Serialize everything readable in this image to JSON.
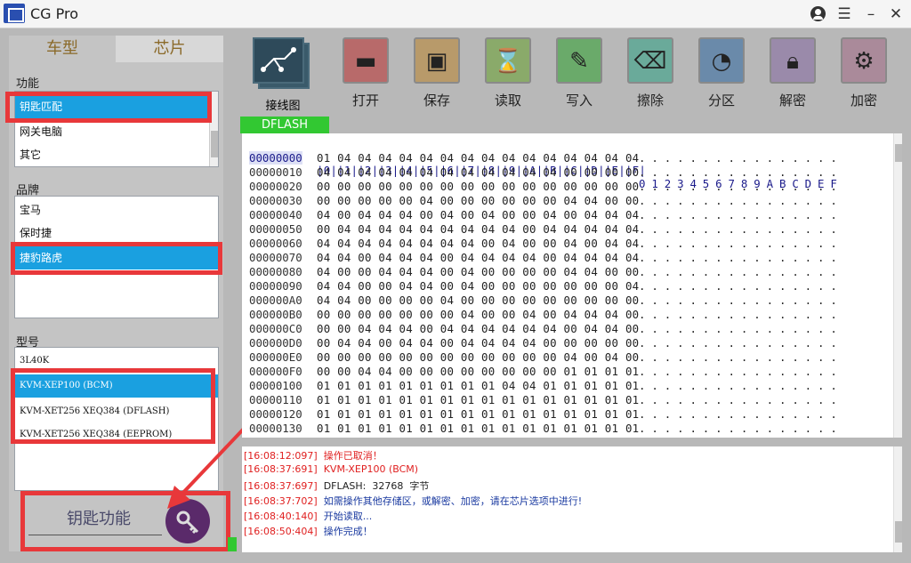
{
  "window": {
    "title": "CG Pro"
  },
  "left": {
    "tabs": [
      "车型",
      "芯片"
    ],
    "function_label": "功能",
    "functions": [
      "钥匙匹配",
      "网关电脑",
      "其它"
    ],
    "brand_label": "品牌",
    "brands": [
      "宝马",
      "保时捷",
      "捷豹路虎"
    ],
    "model_label": "型号",
    "models": [
      "3L40K",
      "KVM-XEP100 (BCM)",
      "KVM-XET256 XEQ384 (DFLASH)",
      "KVM-XET256 XEQ384 (EEPROM)"
    ],
    "key_function_label": "钥匙功能"
  },
  "toolbar": {
    "items": [
      "接线图",
      "打开",
      "保存",
      "读取",
      "写入",
      "擦除",
      "分区",
      "解密",
      "加密"
    ]
  },
  "hex": {
    "tab_label": "DFLASH",
    "header_addr": "--------",
    "header_bytes": "|0||1||2||3||4||5||6||7||8||9||A||B||C||D||E||F|",
    "header_ascii": "0123456789ABCDEF",
    "rows": [
      {
        "addr": "00000000",
        "bytes": "01 04 04 04 04 04 04 04 04 04 04 04 04 04 04 04",
        "ascii": "................"
      },
      {
        "addr": "00000010",
        "bytes": "04 04 04 04 04 04 04 04 04 04 04 04 00 00 00 00",
        "ascii": "................"
      },
      {
        "addr": "00000020",
        "bytes": "00 00 00 00 00 00 00 00 00 00 00 00 00 00 00 00",
        "ascii": "................"
      },
      {
        "addr": "00000030",
        "bytes": "00 00 00 00 00 04 00 00 00 00 00 00 04 04 00 00",
        "ascii": "................"
      },
      {
        "addr": "00000040",
        "bytes": "04 00 04 04 04 00 04 00 04 00 00 04 00 04 04 04",
        "ascii": "................"
      },
      {
        "addr": "00000050",
        "bytes": "00 04 04 04 04 04 04 04 04 04 00 04 04 04 04 04",
        "ascii": "................"
      },
      {
        "addr": "00000060",
        "bytes": "04 04 04 04 04 04 04 04 00 04 00 00 04 00 04 04",
        "ascii": "................"
      },
      {
        "addr": "00000070",
        "bytes": "04 04 00 04 04 04 00 04 04 04 04 00 04 04 04 04",
        "ascii": "................"
      },
      {
        "addr": "00000080",
        "bytes": "04 00 00 04 04 04 00 04 00 00 00 00 04 04 00 00",
        "ascii": "................"
      },
      {
        "addr": "00000090",
        "bytes": "04 04 00 00 04 04 00 04 00 00 00 00 00 00 00 04",
        "ascii": "................"
      },
      {
        "addr": "000000A0",
        "bytes": "04 04 00 00 00 00 04 00 00 00 00 00 00 00 00 00",
        "ascii": "................"
      },
      {
        "addr": "000000B0",
        "bytes": "00 00 00 00 00 00 00 04 00 00 04 00 04 04 04 00",
        "ascii": "................"
      },
      {
        "addr": "000000C0",
        "bytes": "00 00 04 04 04 00 04 04 04 04 04 04 00 04 04 00",
        "ascii": "................"
      },
      {
        "addr": "000000D0",
        "bytes": "00 04 04 00 04 04 00 04 04 04 04 00 00 00 00 00",
        "ascii": "................"
      },
      {
        "addr": "000000E0",
        "bytes": "00 00 00 00 00 00 00 00 00 00 00 00 04 00 04 00",
        "ascii": "................"
      },
      {
        "addr": "000000F0",
        "bytes": "00 00 04 04 00 00 00 00 00 00 00 00 01 01 01 01",
        "ascii": "................"
      },
      {
        "addr": "00000100",
        "bytes": "01 01 01 01 01 01 01 01 01 04 04 01 01 01 01 01",
        "ascii": "................"
      },
      {
        "addr": "00000110",
        "bytes": "01 01 01 01 01 01 01 01 01 01 01 01 01 01 01 01",
        "ascii": "................"
      },
      {
        "addr": "00000120",
        "bytes": "01 01 01 01 01 01 01 01 01 01 01 01 01 01 01 01",
        "ascii": "................"
      },
      {
        "addr": "00000130",
        "bytes": "01 01 01 01 01 01 01 01 01 01 01 01 01 01 01 01",
        "ascii": "................"
      }
    ]
  },
  "log": {
    "lines": [
      {
        "time": "[16:08:12:097]",
        "msg": "操作已取消！",
        "color": "#e02020"
      },
      {
        "time": "[16:08:37:691]",
        "msg": "KVM-XEP100 (BCM)",
        "color": "#e02020"
      },
      {
        "time": "[16:08:37:697]",
        "msg": "DFLASH:  32768  字节",
        "color": "#222222"
      },
      {
        "time": "[16:08:37:702]",
        "msg": "如需操作其他存储区，或解密、加密，请在芯片选项中进行!",
        "color": "#1a3aa0"
      },
      {
        "time": "[16:08:40:140]",
        "msg": "开始读取...",
        "color": "#1a3aa0"
      },
      {
        "time": "[16:08:50:404]",
        "msg": "操作完成！",
        "color": "#1a3aa0"
      }
    ]
  },
  "colors": {
    "selection": "#1aa0e0",
    "annotation": "#e8383a",
    "dflash_tab": "#32c832"
  }
}
